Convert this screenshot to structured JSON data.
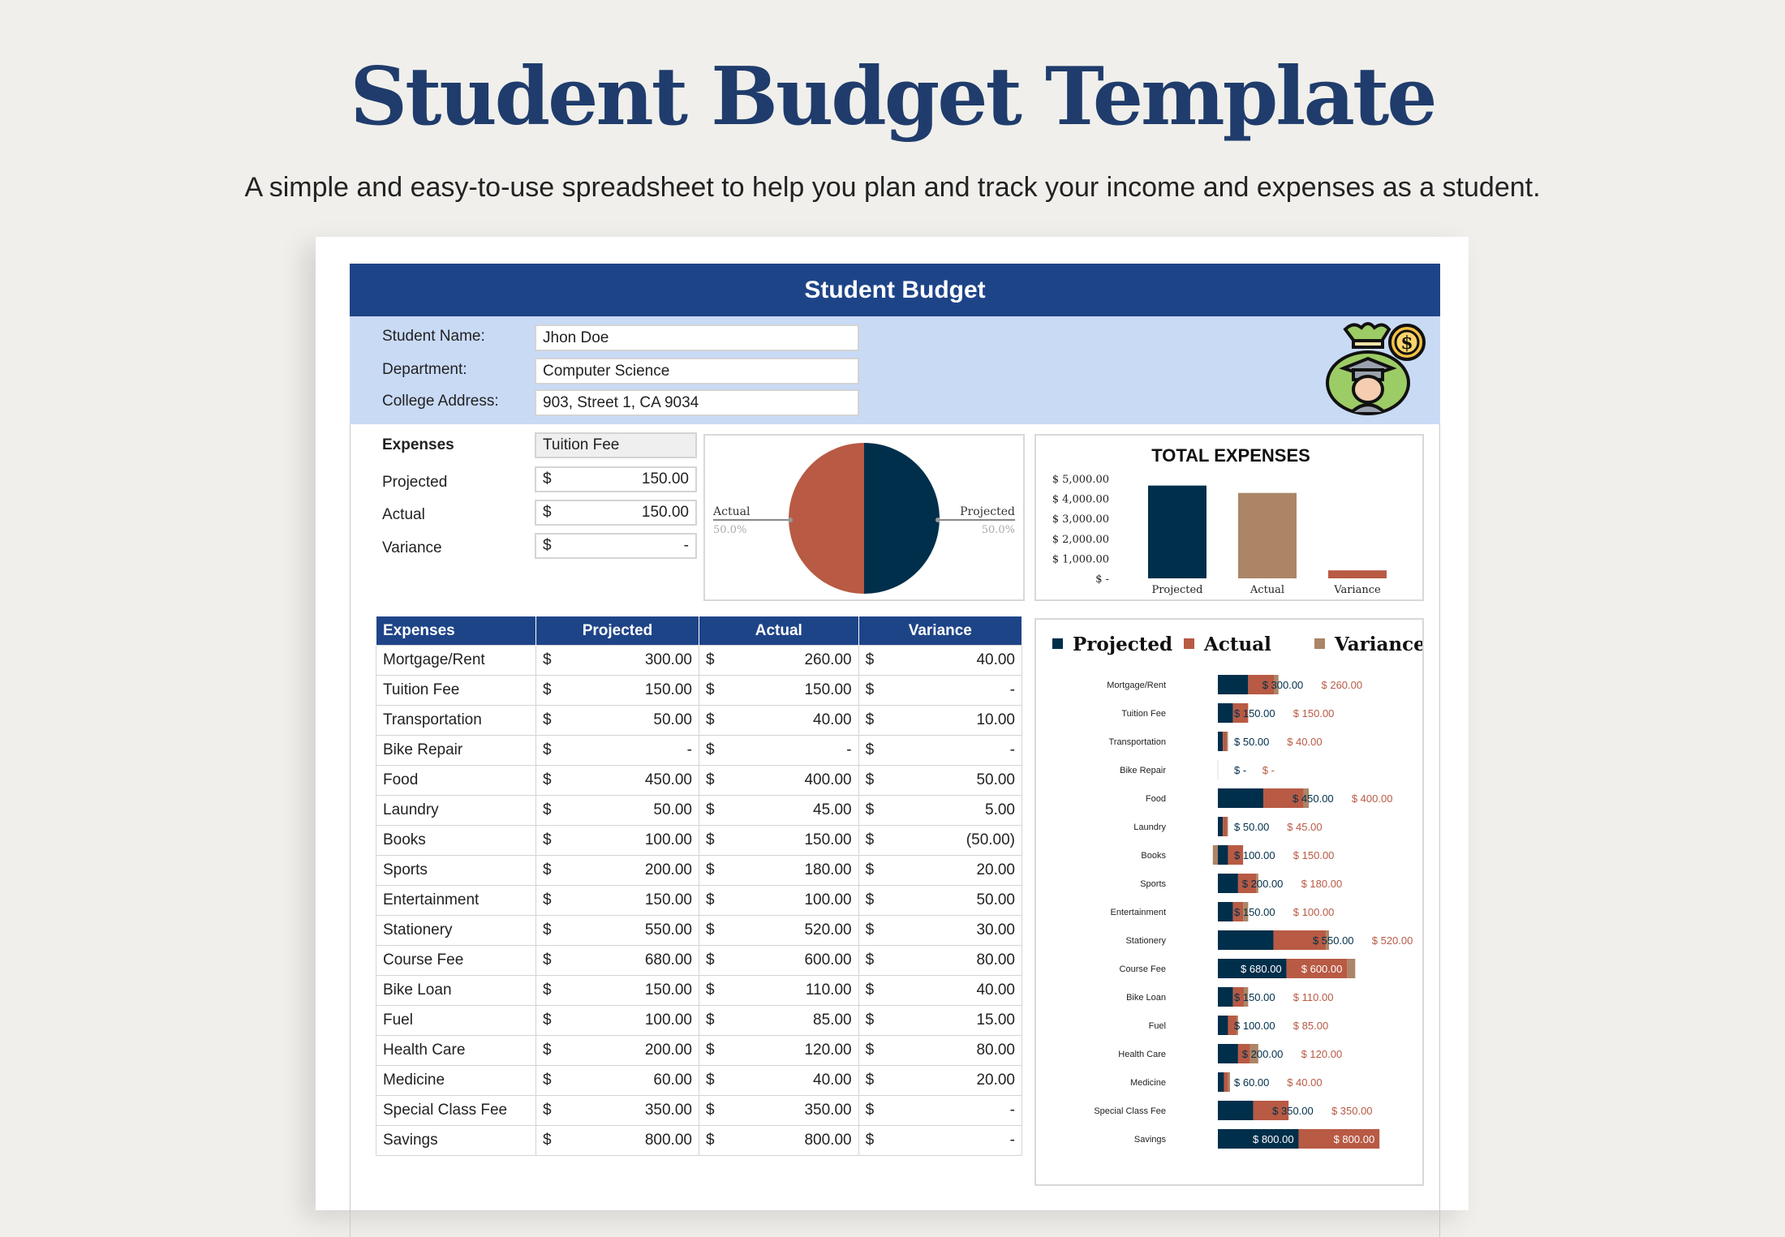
{
  "header": {
    "title": "Student Budget Template",
    "subtitle": "A simple and easy-to-use spreadsheet to help you plan and track your income and expenses as a student."
  },
  "sheet": {
    "title": "Student Budget",
    "info": [
      {
        "label": "Student Name:",
        "value": "Jhon Doe"
      },
      {
        "label": "Department:",
        "value": "Computer Science"
      },
      {
        "label": "College Address:",
        "value": "903, Street 1, CA 9034"
      }
    ],
    "icon": "student-money-bag-icon",
    "selector": {
      "label": "Expenses",
      "selected": "Tuition Fee",
      "rows": [
        {
          "label": "Projected",
          "currency": "$",
          "value": "150.00"
        },
        {
          "label": "Actual",
          "currency": "$",
          "value": "150.00"
        },
        {
          "label": "Variance",
          "currency": "$",
          "value": "-"
        }
      ]
    },
    "table": {
      "columns": [
        "Expenses",
        "Projected",
        "Actual",
        "Variance"
      ],
      "currency": "$",
      "rows": [
        [
          "Mortgage/Rent",
          "300.00",
          "260.00",
          "40.00"
        ],
        [
          "Tuition Fee",
          "150.00",
          "150.00",
          "-"
        ],
        [
          "Transportation",
          "50.00",
          "40.00",
          "10.00"
        ],
        [
          "Bike Repair",
          "-",
          "-",
          "-"
        ],
        [
          "Food",
          "450.00",
          "400.00",
          "50.00"
        ],
        [
          "Laundry",
          "50.00",
          "45.00",
          "5.00"
        ],
        [
          "Books",
          "100.00",
          "150.00",
          "(50.00)"
        ],
        [
          "Sports",
          "200.00",
          "180.00",
          "20.00"
        ],
        [
          "Entertainment",
          "150.00",
          "100.00",
          "50.00"
        ],
        [
          "Stationery",
          "550.00",
          "520.00",
          "30.00"
        ],
        [
          "Course Fee",
          "680.00",
          "600.00",
          "80.00"
        ],
        [
          "Bike Loan",
          "150.00",
          "110.00",
          "40.00"
        ],
        [
          "Fuel",
          "100.00",
          "85.00",
          "15.00"
        ],
        [
          "Health Care",
          "200.00",
          "120.00",
          "80.00"
        ],
        [
          "Medicine",
          "60.00",
          "40.00",
          "20.00"
        ],
        [
          "Special Class Fee",
          "350.00",
          "350.00",
          "-"
        ],
        [
          "Savings",
          "800.00",
          "800.00",
          "-"
        ]
      ]
    }
  },
  "colors": {
    "projected": "#002f4b",
    "actual": "#b85a44",
    "variance": "#ab8566",
    "header": "#1e4488",
    "band": "#c9daf5"
  },
  "chart_data": [
    {
      "type": "pie",
      "slices": [
        {
          "name": "Actual",
          "value": 150,
          "label": "50.0%"
        },
        {
          "name": "Projected",
          "value": 150,
          "label": "50.0%"
        }
      ]
    },
    {
      "type": "bar",
      "title": "TOTAL EXPENSES",
      "categories": [
        "Projected",
        "Actual",
        "Variance"
      ],
      "values": [
        4650,
        4280,
        400
      ],
      "ylim": [
        0,
        5000
      ],
      "yticks": [
        "$ 5,000.00",
        "$ 4,000.00",
        "$ 3,000.00",
        "$ 2,000.00",
        "$ 1,000.00",
        "$ -"
      ],
      "grid": false
    },
    {
      "type": "bar",
      "orientation": "horizontal",
      "stacked": true,
      "legend": [
        "Projected",
        "Actual",
        "Variance"
      ],
      "legend_position": "top",
      "categories": [
        "Mortgage/Rent",
        "Tuition Fee",
        "Transportation",
        "Bike Repair",
        "Food",
        "Laundry",
        "Books",
        "Sports",
        "Entertainment",
        "Stationery",
        "Course Fee",
        "Bike Loan",
        "Fuel",
        "Health Care",
        "Medicine",
        "Special Class Fee",
        "Savings"
      ],
      "series": [
        {
          "name": "Projected",
          "values": [
            300,
            150,
            50,
            0,
            450,
            50,
            100,
            200,
            150,
            550,
            680,
            150,
            100,
            200,
            60,
            350,
            800
          ],
          "labels": [
            "$ 300.00",
            "$ 150.00",
            "$ 50.00",
            "$ -",
            "$ 450.00",
            "$ 50.00",
            "$ 100.00",
            "$ 200.00",
            "$ 150.00",
            "$ 550.00",
            "$ 680.00",
            "$ 150.00",
            "$ 100.00",
            "$ 200.00",
            "$ 60.00",
            "$ 350.00",
            "$ 800.00"
          ]
        },
        {
          "name": "Actual",
          "values": [
            260,
            150,
            40,
            0,
            400,
            45,
            150,
            180,
            100,
            520,
            600,
            110,
            85,
            120,
            40,
            350,
            800
          ],
          "labels": [
            "$ 260.00",
            "$ 150.00",
            "$ 40.00",
            "$ -",
            "$ 400.00",
            "$ 45.00",
            "$ 150.00",
            "$ 180.00",
            "$ 100.00",
            "$ 520.00",
            "$ 600.00",
            "$ 110.00",
            "$ 85.00",
            "$ 120.00",
            "$ 40.00",
            "$ 350.00",
            "$ 800.00"
          ]
        },
        {
          "name": "Variance",
          "values": [
            40,
            0,
            10,
            0,
            50,
            5,
            -50,
            20,
            50,
            30,
            80,
            40,
            15,
            80,
            20,
            0,
            0
          ]
        }
      ]
    }
  ]
}
